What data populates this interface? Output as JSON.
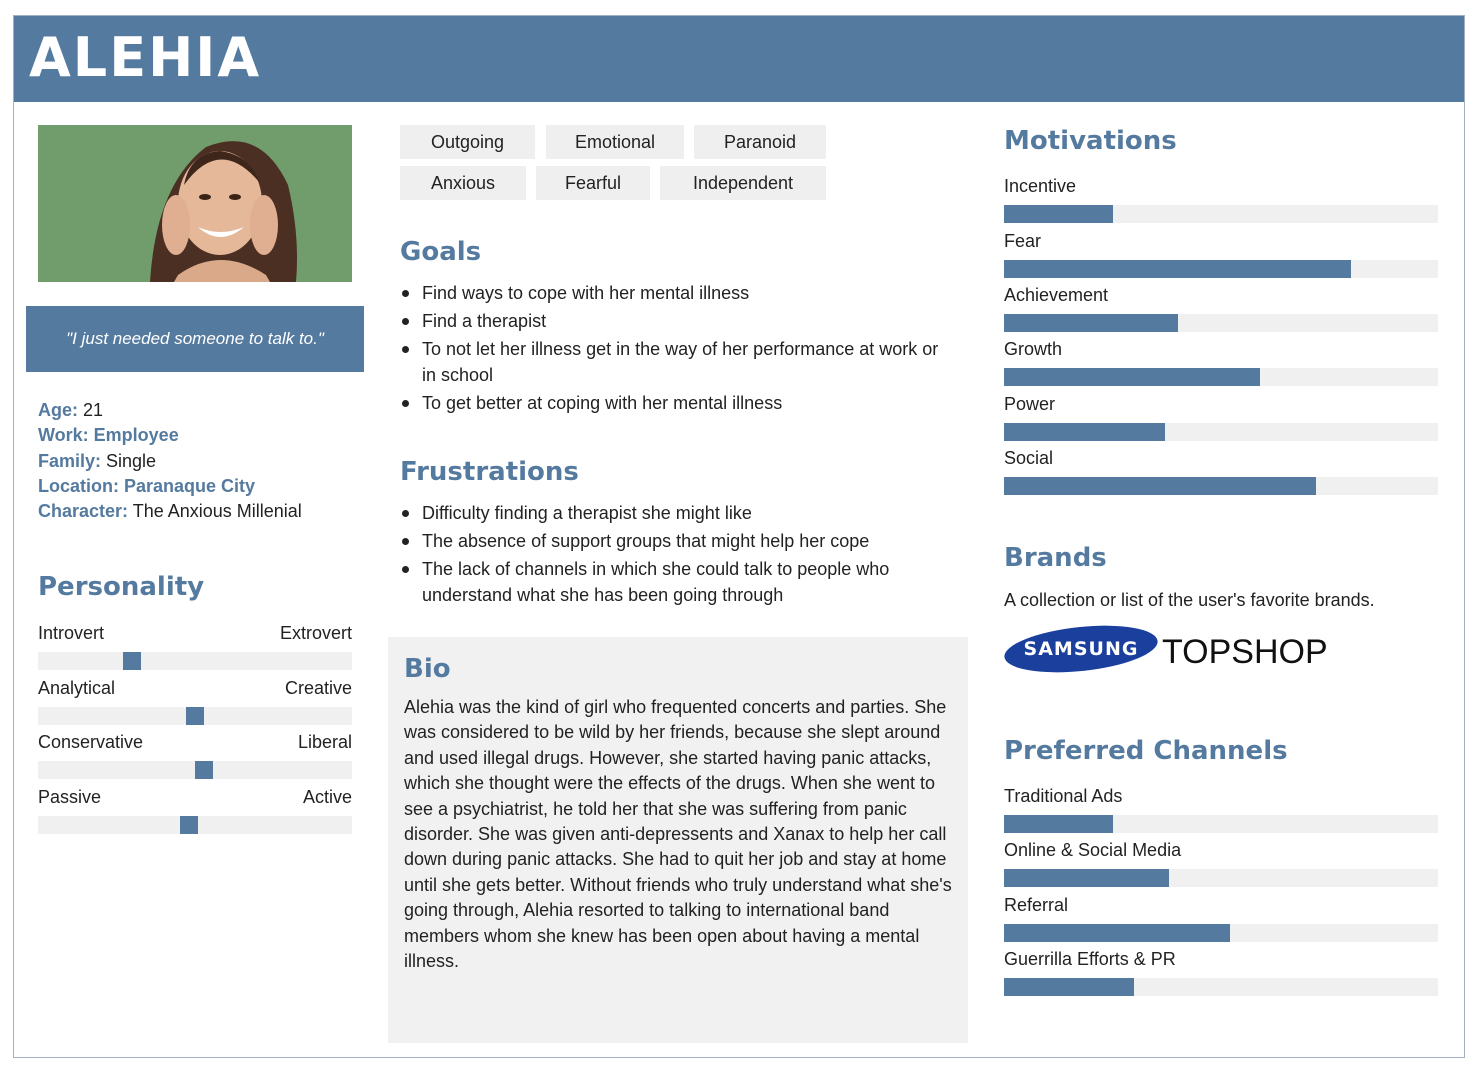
{
  "header": {
    "name": "ALEHIA"
  },
  "quote": "\"I just needed someone to talk to.\"",
  "details": [
    {
      "key": "Age:",
      "value": " 21",
      "value_bold": false
    },
    {
      "key": "Work:",
      "value": " Employee",
      "value_bold": true
    },
    {
      "key": "Family:",
      "value": " Single",
      "value_bold": false
    },
    {
      "key": "Location:",
      "value": "  Paranaque City",
      "value_bold": true
    },
    {
      "key": "Character:",
      "value": " The Anxious Millenial",
      "value_bold": false
    }
  ],
  "personality": {
    "title": "Personality",
    "sliders": [
      {
        "left": "Introvert",
        "right": "Extrovert",
        "position": 0.3
      },
      {
        "left": "Analytical",
        "right": "Creative",
        "position": 0.5
      },
      {
        "left": "Conservative",
        "right": "Liberal",
        "position": 0.53
      },
      {
        "left": "Passive",
        "right": "Active",
        "position": 0.48
      }
    ]
  },
  "traits": [
    "Outgoing",
    "Emotional",
    "Paranoid",
    "Anxious",
    "Fearful",
    "Independent"
  ],
  "goals": {
    "title": "Goals",
    "items": [
      "Find ways to cope with her mental illness",
      "Find a therapist",
      "To not let her illness get in the way of her performance at work or in school",
      "To get better at coping with her mental illness"
    ]
  },
  "frustrations": {
    "title": "Frustrations",
    "items": [
      "Difficulty finding a therapist she might like",
      "The absence of support groups that might help her cope",
      "The lack of channels in which she could talk to people who understand what she has been going through"
    ]
  },
  "bio": {
    "title": "Bio",
    "text": "Alehia was the kind of girl who frequented concerts and parties. She was considered to be wild by her friends, because she slept around and used illegal drugs. However, she started having panic attacks, which she thought were the effects of the drugs. When she went to see a psychiatrist, he told her that she was suffering from panic disorder. She was given anti-depressents and Xanax to help her call down during panic attacks. She had to quit her job and stay at home until she gets better. Without friends who truly understand what she's going through, Alehia resorted to talking to international band members whom she knew has been open about having a mental illness."
  },
  "motivations": {
    "title": "Motivations",
    "items": [
      {
        "label": "Incentive",
        "value": 0.25
      },
      {
        "label": "Fear",
        "value": 0.8
      },
      {
        "label": "Achievement",
        "value": 0.4
      },
      {
        "label": "Growth",
        "value": 0.59
      },
      {
        "label": "Power",
        "value": 0.37
      },
      {
        "label": "Social",
        "value": 0.72
      }
    ]
  },
  "brands": {
    "title": "Brands",
    "description": "A collection or list of the user's favorite brands.",
    "logos": [
      "SAMSUNG",
      "TOPSHOP"
    ]
  },
  "channels": {
    "title": "Preferred Channels",
    "items": [
      {
        "label": "Traditional Ads",
        "value": 0.25
      },
      {
        "label": "Online & Social Media",
        "value": 0.38
      },
      {
        "label": "Referral",
        "value": 0.52
      },
      {
        "label": "Guerrilla Efforts & PR",
        "value": 0.3
      }
    ]
  },
  "colors": {
    "accent": "#557a9f",
    "panel": "#f1f1f1",
    "track": "#f0f0f0"
  }
}
